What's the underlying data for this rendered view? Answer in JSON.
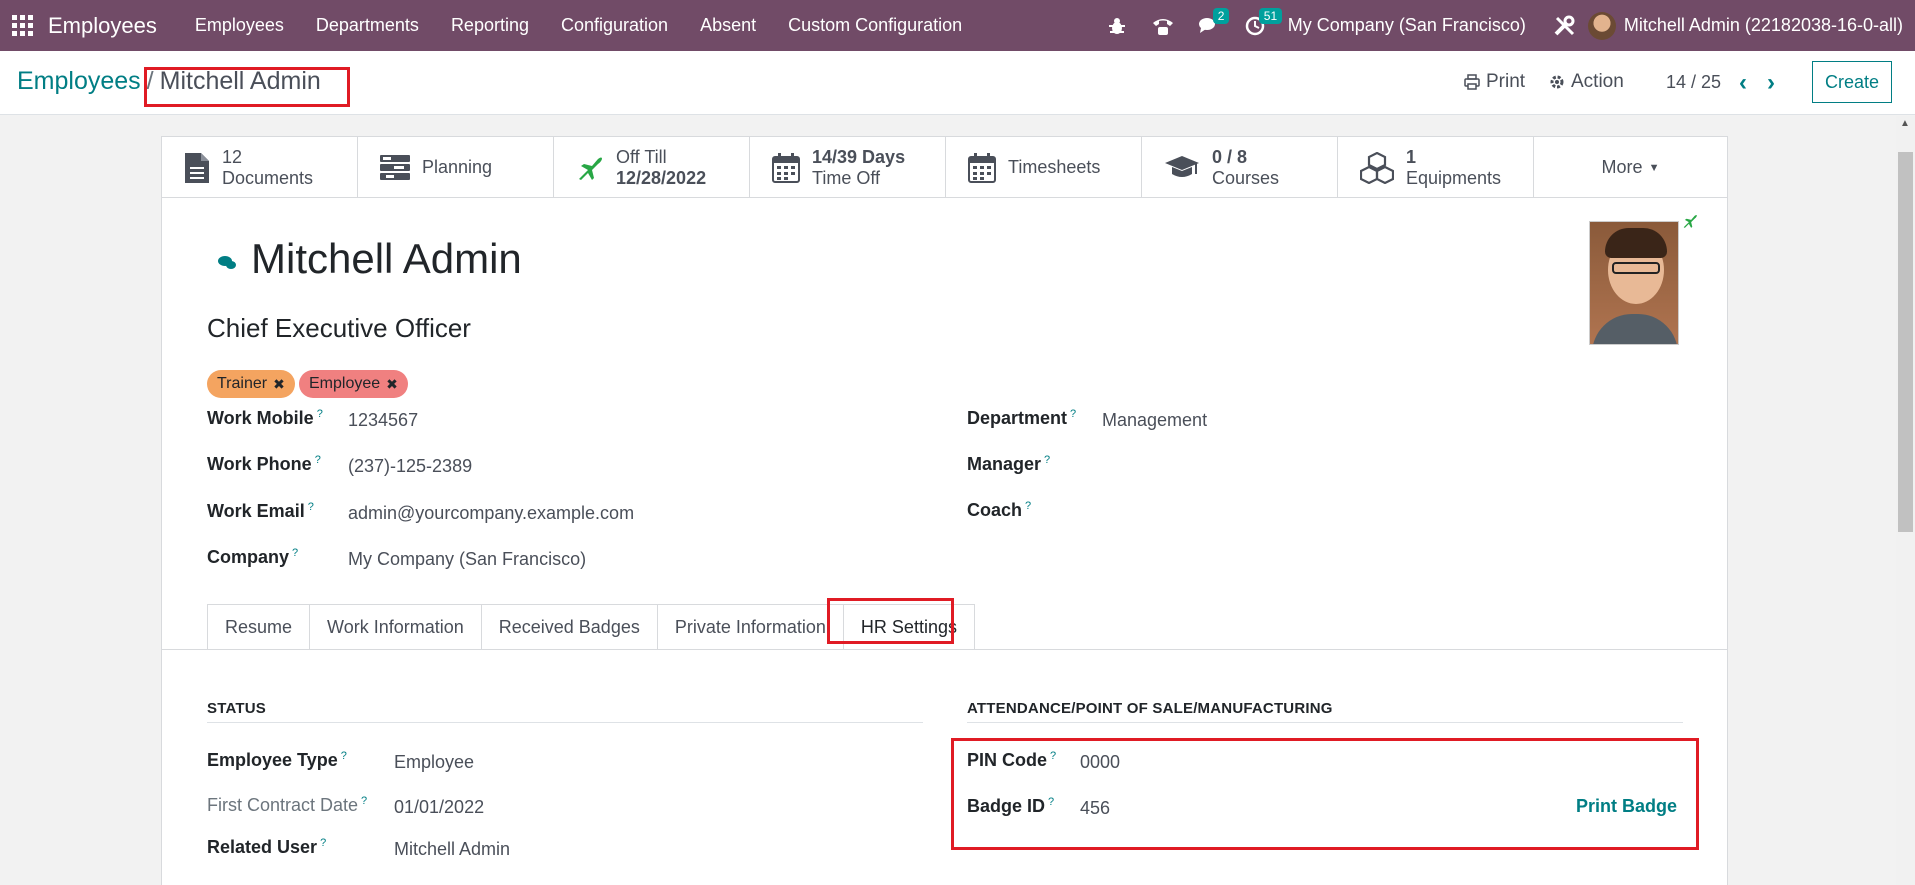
{
  "nav": {
    "app_name": "Employees",
    "menu": [
      "Employees",
      "Departments",
      "Reporting",
      "Configuration",
      "Absent",
      "Custom Configuration"
    ],
    "messages_count": "2",
    "activities_count": "51",
    "company": "My Company (San Francisco)",
    "user": "Mitchell Admin (22182038-16-0-all)"
  },
  "breadcrumb": {
    "parent": "Employees",
    "separator": "/",
    "current": "Mitchell Admin"
  },
  "control": {
    "print_label": "Print",
    "action_label": "Action",
    "pager": "14 / 25",
    "prev": "‹",
    "next": "›",
    "create_label": "Create"
  },
  "smart_buttons": [
    {
      "icon": "document-icon",
      "value": "12",
      "label": "Documents"
    },
    {
      "icon": "planning-icon",
      "label": "Planning"
    },
    {
      "icon": "plane-icon",
      "value": "Off Till",
      "label": "12/28/2022"
    },
    {
      "icon": "calendar-icon",
      "value": "14/39 Days",
      "label": "Time Off"
    },
    {
      "icon": "calendar-icon",
      "label": "Timesheets"
    },
    {
      "icon": "graduation-cap-icon",
      "value": "0 / 8",
      "label": "Courses"
    },
    {
      "icon": "cubes-icon",
      "value": "1",
      "label": "Equipments"
    },
    {
      "label": "More"
    }
  ],
  "employee": {
    "name": "Mitchell Admin",
    "job_title": "Chief Executive Officer",
    "tags": [
      {
        "label": "Trainer",
        "color": "#f4a460"
      },
      {
        "label": "Employee",
        "color": "#f08080"
      }
    ],
    "fields_left": [
      {
        "label": "Work Mobile",
        "value": "1234567"
      },
      {
        "label": "Work Phone",
        "value": "(237)-125-2389"
      },
      {
        "label": "Work Email",
        "value": "admin@yourcompany.example.com"
      },
      {
        "label": "Company",
        "value": "My Company (San Francisco)"
      }
    ],
    "fields_right": [
      {
        "label": "Department",
        "value": "Management"
      },
      {
        "label": "Manager",
        "value": ""
      },
      {
        "label": "Coach",
        "value": ""
      }
    ]
  },
  "tabs": [
    "Resume",
    "Work Information",
    "Received Badges",
    "Private Information",
    "HR Settings"
  ],
  "hr_settings": {
    "status_title": "STATUS",
    "status_fields": [
      {
        "label": "Employee Type",
        "value": "Employee"
      },
      {
        "label": "First Contract Date",
        "value": "01/01/2022"
      },
      {
        "label": "Related User",
        "value": "Mitchell Admin"
      }
    ],
    "attendance_title": "ATTENDANCE/POINT OF SALE/MANUFACTURING",
    "attendance_fields": [
      {
        "label": "PIN Code",
        "value": "0000"
      },
      {
        "label": "Badge ID",
        "value": "456"
      }
    ],
    "print_badge_label": "Print Badge"
  },
  "help_marker": "?",
  "colors": {
    "nav": "#714b67",
    "primary": "#017e84",
    "highlight": "#e01b24"
  }
}
